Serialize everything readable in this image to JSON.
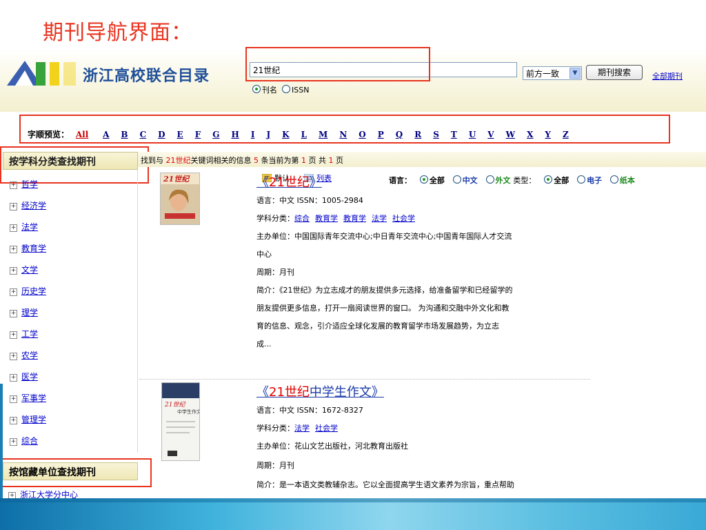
{
  "slide": {
    "title": "期刊导航界面："
  },
  "header": {
    "logo_text": "浙江高校联合目录",
    "search_value": "21世纪",
    "radio_title": "刊名",
    "radio_issn": "ISSN",
    "match_mode": "前方一致",
    "search_button": "期刊搜索",
    "all_journals": "全部期刊"
  },
  "alphabet": {
    "label": "字顺预览：",
    "all": "All",
    "letters": [
      "A",
      "B",
      "C",
      "D",
      "E",
      "F",
      "G",
      "H",
      "I",
      "J",
      "K",
      "L",
      "M",
      "N",
      "O",
      "P",
      "Q",
      "R",
      "S",
      "T",
      "U",
      "V",
      "W",
      "X",
      "Y",
      "Z"
    ]
  },
  "sidebar": {
    "subject_title": "按学科分类查找期刊",
    "subjects": [
      "哲学",
      "经济学",
      "法学",
      "教育学",
      "文学",
      "历史学",
      "理学",
      "工学",
      "农学",
      "医学",
      "军事学",
      "管理学",
      "综合"
    ],
    "holding_title": "按馆藏单位查找期刊",
    "holding_first": "浙江大学分中心"
  },
  "results_bar": {
    "p1": "找到与 ",
    "keyword": "21世纪",
    "p2": "关键词相关的信息 ",
    "count": "5",
    "p3": " 条当前为第 ",
    "page": "1",
    "p4": " 页 共 ",
    "total": "1",
    "p5": " 页"
  },
  "view": {
    "default": "默认",
    "list": "列表"
  },
  "filters": {
    "lang_label": "语言：",
    "lang_all": "全部",
    "lang_cn": "中文",
    "lang_foreign": "外文",
    "type_label": "类型：",
    "type_all": "全部",
    "type_e": "电子",
    "type_paper": "纸本"
  },
  "results": [
    {
      "title_prefix": "《",
      "title_highlight": "21世纪",
      "title_rest": "》",
      "lang_issn": "语言：中文 ISSN：1005-2984",
      "subject_label": "学科分类：",
      "subjects": [
        "综合",
        "教育学",
        "教育学",
        "法学",
        "社会学"
      ],
      "sponsor_1": "主办单位：中国国际青年交流中心;中日青年交流中心;中国青年国际人才交流",
      "sponsor_2": "中心",
      "period": "周期：月刊",
      "intro_1": "简介：《21世纪》为立志成才的朋友提供多元选择，给准备留学和已经留学的",
      "intro_2": "朋友提供更多信息，打开一扇阅读世界的窗口。 为沟通和交融中外文化和教",
      "intro_3": "育的信息、观念，引介适应全球化发展的教育留学市场发展趋势，为立志",
      "intro_4": "成..."
    },
    {
      "title_prefix": "《",
      "title_highlight": "21世纪",
      "title_rest": "中学生作文》",
      "lang_issn": "语言：中文 ISSN：1672-8327",
      "subject_label": "学科分类：",
      "subjects": [
        "法学",
        "社会学"
      ],
      "sponsor_1": "主办单位：花山文艺出版社，河北教育出版社",
      "period": "周期：月刊",
      "intro_1": "简介：是一本语文类教辅杂志。它以全面提高学生语文素养为宗旨，重点帮助"
    }
  ],
  "colors": {
    "annotation_red": "#e8331f",
    "link_blue": "#0000cc",
    "highlight_red": "#e00000"
  }
}
